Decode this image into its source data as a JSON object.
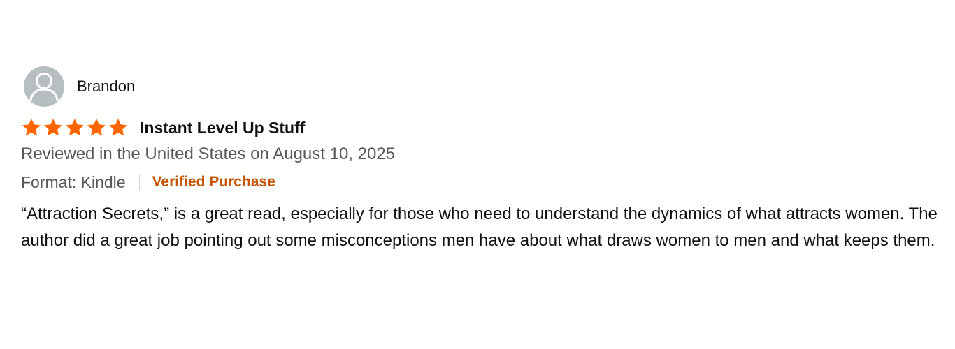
{
  "reviewer": {
    "name": "Brandon",
    "avatar_icon": "person-silhouette-icon"
  },
  "review": {
    "rating": 5,
    "rating_max": 5,
    "star_color": "#ff6600",
    "title": "Instant Level Up Stuff",
    "date_text": "Reviewed in the United States on August 10, 2025",
    "format_text": "Format: Kindle",
    "verified_text": "Verified Purchase",
    "verified_color": "#c45500",
    "body": "“Attraction Secrets,” is a great read, especially for those who need to understand the dynamics of what attracts women. The author did a great job pointing out some misconceptions men have about what draws women to men and what keeps them."
  }
}
